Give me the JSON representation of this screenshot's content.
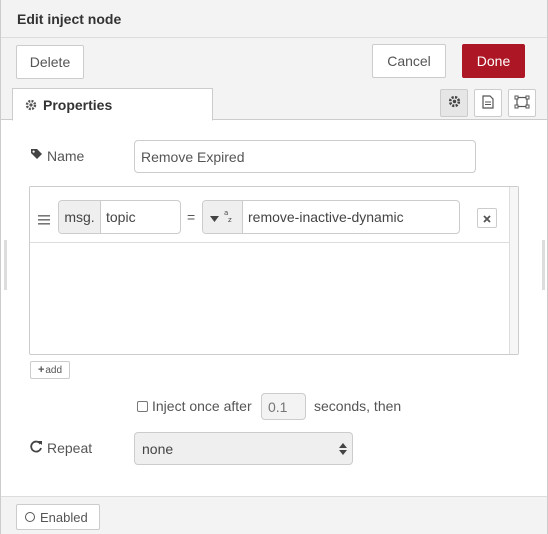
{
  "header": {
    "title": "Edit inject node"
  },
  "toolbar": {
    "delete_label": "Delete",
    "cancel_label": "Cancel",
    "done_label": "Done"
  },
  "tabs": [
    {
      "label": "Properties",
      "icon": "gear-icon"
    }
  ],
  "tab_icons": [
    "gear-icon",
    "document-icon",
    "frame-icon"
  ],
  "form": {
    "name_label": "Name",
    "name_value": "Remove Expired",
    "property": {
      "prefix": "msg.",
      "key": "topic",
      "equals": "=",
      "type_icon": "az-string-icon",
      "value": "remove-inactive-dynamic"
    },
    "add_label": "add",
    "inject_once_label": "Inject once after",
    "inject_once_checked": false,
    "delay_placeholder": "0.1",
    "seconds_label": "seconds, then",
    "repeat_label": "Repeat",
    "repeat_value": "none"
  },
  "footer": {
    "enabled_label": "Enabled"
  },
  "colors": {
    "done_bg": "#ad1625",
    "panel_bg": "#f3f3f3",
    "border": "#cccccc"
  }
}
